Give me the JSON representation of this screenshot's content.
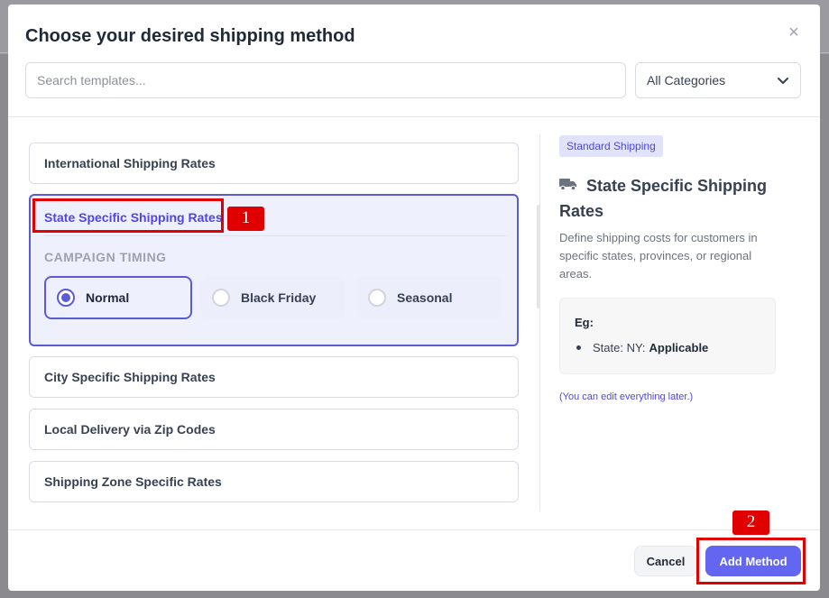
{
  "modal": {
    "title": "Choose your desired shipping method",
    "close_symbol": "×"
  },
  "search": {
    "placeholder": "Search templates..."
  },
  "category_select": {
    "selected": "All Categories"
  },
  "templates": [
    {
      "label": "International Shipping Rates"
    },
    {
      "label": "State Specific Shipping Rates",
      "active": true
    },
    {
      "label": "City Specific Shipping Rates"
    },
    {
      "label": "Local Delivery via Zip Codes"
    },
    {
      "label": "Shipping Zone Specific Rates"
    }
  ],
  "campaign_timing": {
    "label": "CAMPAIGN TIMING",
    "options": [
      {
        "label": "Normal",
        "selected": true
      },
      {
        "label": "Black Friday",
        "selected": false
      },
      {
        "label": "Seasonal",
        "selected": false
      }
    ]
  },
  "detail": {
    "badge": "Standard Shipping",
    "icon": "truck-icon",
    "title": "State Specific Shipping Rates",
    "description": "Define shipping costs for customers in specific states, provinces, or regional areas.",
    "example_title": "Eg:",
    "example_key": "State: NY:",
    "example_value": "Applicable",
    "edit_note": "(You can edit everything later.)"
  },
  "footer": {
    "cancel_label": "Cancel",
    "add_label": "Add Method"
  },
  "annotations": [
    {
      "label": "1"
    },
    {
      "label": "2"
    }
  ],
  "colors": {
    "accent": "#5b5bd6",
    "primary_button": "#6366f1",
    "annotation": "#e00000"
  }
}
